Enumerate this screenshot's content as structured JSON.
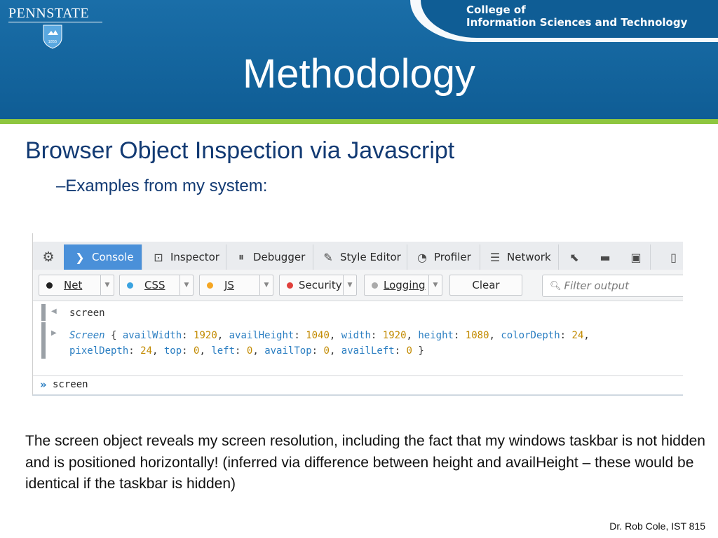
{
  "header": {
    "logo_text": "PENNSTATE",
    "logo_year": "1855",
    "college_line1": "College of",
    "college_line2": "Information Sciences and Technology",
    "title": "Methodology"
  },
  "content": {
    "heading": "Browser Object Inspection via Javascript",
    "subheading": "–Examples from my system:",
    "body": "The screen object reveals my screen resolution, including the fact that my windows taskbar is not hidden and is positioned horizontally!  (inferred via difference between height and availHeight – these would be identical if the taskbar is hidden)",
    "footer": "Dr. Rob Cole, IST 815"
  },
  "devtools": {
    "tabs": [
      {
        "label": "",
        "icon": "gear-icon"
      },
      {
        "label": "Console",
        "icon": "console-chevron-icon"
      },
      {
        "label": "Inspector",
        "icon": "inspector-icon"
      },
      {
        "label": "Debugger",
        "icon": "debugger-icon"
      },
      {
        "label": "Style Editor",
        "icon": "style-editor-icon"
      },
      {
        "label": "Profiler",
        "icon": "profiler-icon"
      },
      {
        "label": "Network",
        "icon": "network-icon"
      }
    ],
    "filters": [
      {
        "label": "Net",
        "color": "#222222"
      },
      {
        "label": "CSS",
        "color": "#3ba3e0"
      },
      {
        "label": "JS",
        "color": "#f5a623"
      },
      {
        "label": "Security",
        "color": "#e0403c"
      },
      {
        "label": "Logging",
        "color": "#aaaaaa"
      }
    ],
    "clear_label": "Clear",
    "filter_placeholder": "Filter output",
    "output_input": "screen",
    "output_result": {
      "object": "Screen",
      "props": [
        {
          "key": "availWidth",
          "value": "1920"
        },
        {
          "key": "availHeight",
          "value": "1040"
        },
        {
          "key": "width",
          "value": "1920"
        },
        {
          "key": "height",
          "value": "1080"
        },
        {
          "key": "colorDepth",
          "value": "24"
        },
        {
          "key": "pixelDepth",
          "value": "24"
        },
        {
          "key": "top",
          "value": "0"
        },
        {
          "key": "left",
          "value": "0"
        },
        {
          "key": "availTop",
          "value": "0"
        },
        {
          "key": "availLeft",
          "value": "0"
        }
      ]
    },
    "command_line": "screen"
  }
}
